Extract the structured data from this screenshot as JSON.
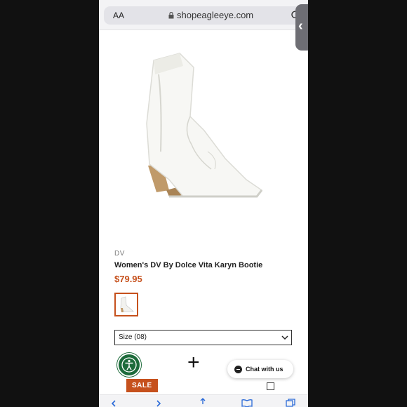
{
  "browser": {
    "text_size_label": "AA",
    "url": "shopeagleeye.com"
  },
  "product": {
    "brand": "DV",
    "name": "Women's DV By Dolce Vita Karyn Bootie",
    "price": "$79.95",
    "size_select_value": "Size  (08)"
  },
  "widgets": {
    "chat_label": "Chat with us",
    "sale_badge": "SALE"
  },
  "colors": {
    "price": "#c6511d",
    "accessibility": "#1c6b3a"
  },
  "icons": {
    "side_tab": "chevron-left-icon",
    "nav": [
      "back-arrow-icon",
      "forward-arrow-icon",
      "share-icon",
      "bookmarks-icon",
      "tabs-icon"
    ]
  }
}
